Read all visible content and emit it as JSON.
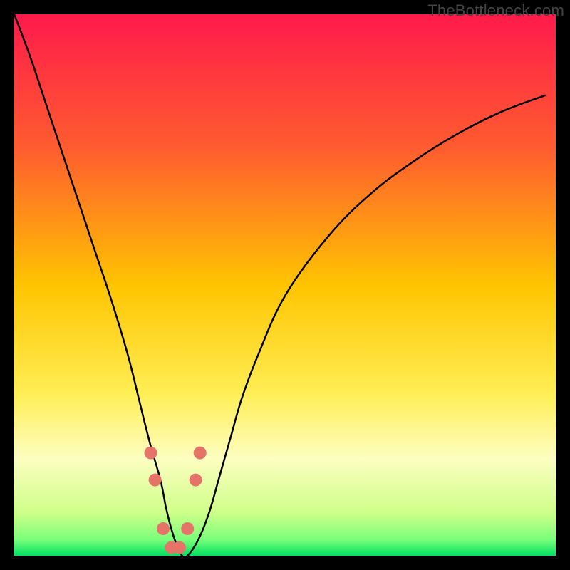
{
  "watermark": "TheBottleneck.com",
  "chart_data": {
    "type": "line",
    "title": "",
    "xlabel": "",
    "ylabel": "",
    "xlim": [
      0,
      100
    ],
    "ylim": [
      0,
      100
    ],
    "gradient_stops": [
      {
        "offset": 0.0,
        "color": "#ff1a4b"
      },
      {
        "offset": 0.25,
        "color": "#ff5d2f"
      },
      {
        "offset": 0.5,
        "color": "#ffc400"
      },
      {
        "offset": 0.7,
        "color": "#ffee55"
      },
      {
        "offset": 0.82,
        "color": "#fdfec0"
      },
      {
        "offset": 0.92,
        "color": "#cfff8a"
      },
      {
        "offset": 0.97,
        "color": "#7aff7a"
      },
      {
        "offset": 1.0,
        "color": "#00e060"
      }
    ],
    "series": [
      {
        "name": "bottleneck-curve",
        "stroke": "#000000",
        "stroke_width": 2.5,
        "x": [
          0,
          3,
          6,
          9,
          12,
          15,
          18,
          21,
          23,
          25,
          27,
          28,
          29,
          30,
          31,
          32,
          34,
          36,
          38,
          40,
          42,
          45,
          50,
          58,
          66,
          74,
          82,
          90,
          98
        ],
        "values": [
          100,
          92,
          83,
          74,
          65,
          56,
          47,
          37,
          29,
          21,
          14,
          9,
          5,
          2,
          0,
          0,
          3,
          8,
          15,
          22,
          29,
          37,
          48,
          59,
          67,
          73,
          78,
          82,
          85
        ]
      }
    ],
    "markers": {
      "name": "curve-markers",
      "color": "#e57368",
      "radius": 9,
      "x": [
        25.2,
        26.0,
        27.5,
        29.0,
        30.5,
        32.0,
        33.5,
        34.3
      ],
      "values": [
        19.0,
        14.0,
        5.0,
        1.5,
        1.5,
        5.0,
        14.0,
        19.0
      ]
    }
  }
}
